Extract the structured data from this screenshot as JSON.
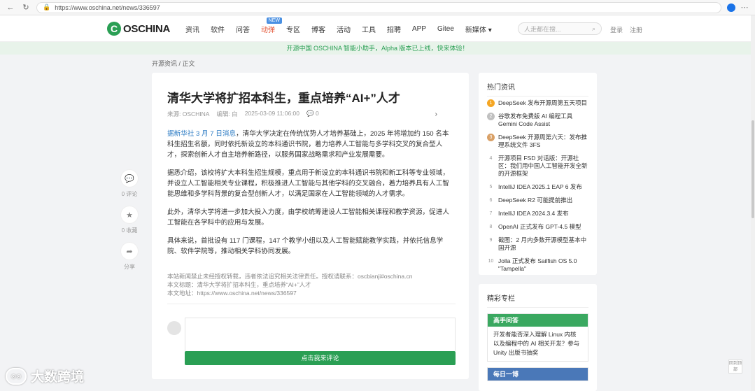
{
  "browser": {
    "url": "https://www.oschina.net/news/336597"
  },
  "header": {
    "logo_mark": "C",
    "logo_text": "OSCHINA",
    "nav": [
      {
        "label": "资讯",
        "special": false,
        "badge": ""
      },
      {
        "label": "软件",
        "special": false,
        "badge": ""
      },
      {
        "label": "问答",
        "special": false,
        "badge": ""
      },
      {
        "label": "动弹",
        "special": true,
        "badge": "NEW"
      },
      {
        "label": "专区",
        "special": false,
        "badge": ""
      },
      {
        "label": "博客",
        "special": false,
        "badge": ""
      },
      {
        "label": "活动",
        "special": false,
        "badge": ""
      },
      {
        "label": "工具",
        "special": false,
        "badge": ""
      },
      {
        "label": "招聘",
        "special": false,
        "badge": ""
      },
      {
        "label": "APP",
        "special": false,
        "badge": ""
      },
      {
        "label": "Gitee",
        "special": false,
        "badge": ""
      },
      {
        "label": "新媒体 ▾",
        "special": false,
        "badge": ""
      }
    ],
    "search_placeholder": "人走都在搜...",
    "login": "登录",
    "register": "注册"
  },
  "notice": "开源中国 OSCHINA 智能小助手，Alpha 版本已上线，快来体验！",
  "breadcrumb": "开源资讯 / 正文",
  "actions": [
    {
      "icon": "comment-icon",
      "glyph": "💬",
      "label": "0 评论"
    },
    {
      "icon": "star-icon",
      "glyph": "★",
      "label": "0 收藏"
    },
    {
      "icon": "share-icon",
      "glyph": "➦",
      "label": "分享"
    }
  ],
  "article": {
    "title": "清华大学将扩招本科生，重点培养“AI+”人才",
    "source": "来源: OSCHINA",
    "editor": "编辑: 白",
    "date": "2025-03-09 11:06:00",
    "comments": "0",
    "p1_highlight": "据新华社 3 月 7 日消息",
    "p1_rest": "，清华大学决定在传统优势人才培养基础上，2025 年将增加约 150 名本科生招生名额，同时依托新设立的本科通识书院，着力培养人工智能与多学科交叉的复合型人才，探索创新人才自主培养新路径，以服务国家战略需求和产业发展需要。",
    "p2": "据悉介绍，该校将扩大本科生招生规模，重点用于新设立的本科通识书院和新工科等专业领域，并设立人工智能相关专业课程，积极推进人工智能与其他学科的交叉融合，着力培养具有人工智能思维和多学科背景的复合型创新人才，以满足国家在人工智能领域的人才需求。",
    "p3": "此外，清华大学将进一步加大投入力度，由学校统筹建设人工智能相关课程和教学资源，促进人工智能在各学科中的应用与发展。",
    "p4": "具体来说，首批设有 117 门课程，147 个教学小组以及人工智能赋能教学实践，并依托信息学院、软件学院等，推动相关学科协同发展。",
    "copyright_1": "本站新闻禁止未经授权转载，违者依法追究相关法律责任。授权请联系：oscbianji#oschina.cn",
    "copyright_2": "本文标题：清华大学将扩招本科生，重点培养“AI+”人才",
    "copyright_3": "本文地址：https://www.oschina.net/news/336597",
    "comment_submit": "点击我来评论"
  },
  "hot": {
    "title": "热门资讯",
    "items": [
      {
        "n": "1",
        "text": "DeepSeek 发布开源周第五天项目",
        "top": true,
        "color": "#f5a623"
      },
      {
        "n": "2",
        "text": "谷歌发布免费版 AI 编程工具 Gemini Code Assist",
        "top": true,
        "color": "#c0c0c0"
      },
      {
        "n": "3",
        "text": "DeepSeek 开源周第六天：发布推理系统文件 3FS",
        "top": true,
        "color": "#d9a066"
      },
      {
        "n": "4",
        "text": "开源项目 FSD 对话版：开源社区：我们用中国人工智能开发全新的开源框架",
        "top": false,
        "color": ""
      },
      {
        "n": "5",
        "text": "IntelliJ IDEA 2025.1 EAP 6 发布",
        "top": false,
        "color": ""
      },
      {
        "n": "6",
        "text": "DeepSeek R2 可能提前推出",
        "top": false,
        "color": ""
      },
      {
        "n": "7",
        "text": "IntelliJ IDEA 2024.3.4 发布",
        "top": false,
        "color": ""
      },
      {
        "n": "8",
        "text": "OpenAI 正式发布 GPT-4.5 模型",
        "top": false,
        "color": ""
      },
      {
        "n": "9",
        "text": "截图：2 月内多数开源模型基本中国开源",
        "top": false,
        "color": ""
      },
      {
        "n": "10",
        "text": "Jolla 正式发布 Sailfish OS 5.0 \"Tampella\"",
        "top": false,
        "color": ""
      }
    ]
  },
  "featured": {
    "title": "精彩专栏",
    "blocks": [
      {
        "head": "高手问答",
        "color": "#3aa860",
        "body": "开发者能否深入理解 Linux 内核以及编程中的 AI 相关开发？参与 Unity 出版书抽奖"
      },
      {
        "head": "每日一博",
        "color": "#4a78b8",
        "body": ""
      }
    ]
  },
  "back_to_top": "回到顶部",
  "watermark": "大数跨境"
}
